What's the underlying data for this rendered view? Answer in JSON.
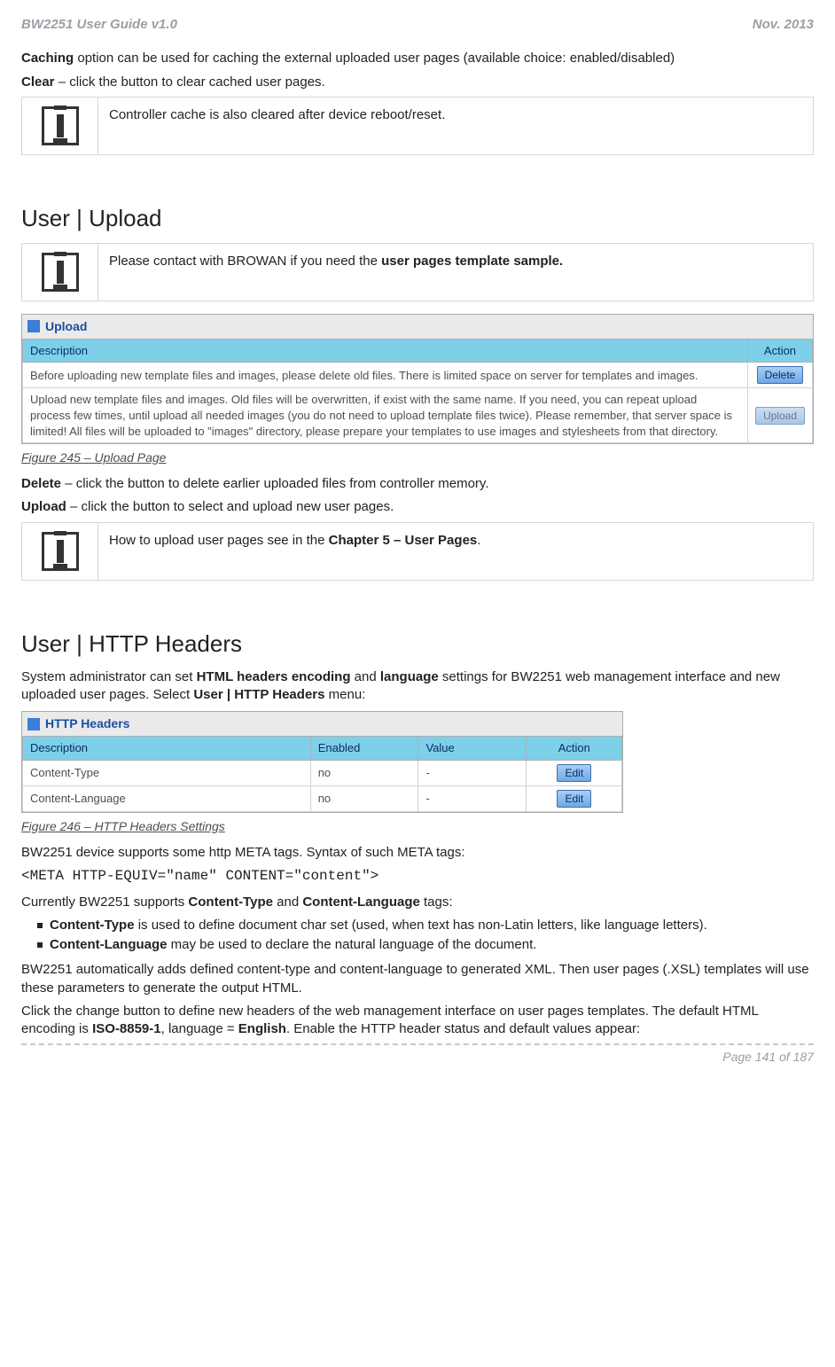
{
  "header": {
    "left": "BW2251 User Guide v1.0",
    "right": "Nov.  2013"
  },
  "footer": {
    "text": "Page 141 of 187"
  },
  "intro": {
    "caching_line": " option can be used for caching the external uploaded user pages (available choice: enabled/disabled)",
    "caching_bold": "Caching",
    "clear_bold": "Clear",
    "clear_line": " – click the button to clear cached user pages.",
    "info1": "Controller cache is also cleared after device reboot/reset."
  },
  "upload": {
    "heading": "User | Upload",
    "info_pre": "Please contact with BROWAN if you need the ",
    "info_bold": "user pages template sample.",
    "panel_title": "Upload",
    "th_desc": "Description",
    "th_action": "Action",
    "rows": [
      {
        "desc": "Before uploading new template files and images, please delete old files. There is limited space on server for templates and images.",
        "btn": "Delete",
        "disabled": false
      },
      {
        "desc": "Upload new template files and images. Old files will be overwritten, if exist with the same name. If you need, you can repeat upload process few times, until upload all needed images (you do not need to upload template files twice). Please remember, that server space is limited! All files will be uploaded to \"images\" directory, please prepare your templates to use images and stylesheets from that directory.",
        "btn": "Upload",
        "disabled": true
      }
    ],
    "fig": "Figure 245 – Upload Page",
    "delete_bold": "Delete",
    "delete_line": " – click the button to delete earlier uploaded files from controller memory.",
    "upload_bold": "Upload",
    "upload_line": " – click the button to select and upload new user pages.",
    "info2_pre": "How to upload user pages see in the ",
    "info2_bold": "Chapter 5 – User Pages",
    "info2_post": "."
  },
  "http": {
    "heading": "User | HTTP Headers",
    "intro_pre": "System administrator can set ",
    "intro_b1": "HTML headers encoding",
    "intro_mid1": " and ",
    "intro_b2": "language",
    "intro_mid2": " settings for BW2251 web management interface and new uploaded user pages. Select ",
    "intro_b3": "User | HTTP Headers",
    "intro_post": " menu:",
    "panel_title": "HTTP Headers",
    "th_desc": "Description",
    "th_enabled": "Enabled",
    "th_value": "Value",
    "th_action": "Action",
    "rows": [
      {
        "desc": "Content-Type",
        "enabled": "no",
        "value": "-",
        "btn": "Edit"
      },
      {
        "desc": "Content-Language",
        "enabled": "no",
        "value": "-",
        "btn": "Edit"
      }
    ],
    "fig": "Figure 246 – HTTP Headers Settings",
    "meta_intro": "BW2251 device supports some http META tags. Syntax of such META tags:",
    "meta_code": "<META HTTP-EQUIV=\"name\" CONTENT=\"content\">",
    "supports_pre": "Currently BW2251 supports ",
    "supports_b1": "Content-Type",
    "supports_mid": " and ",
    "supports_b2": "Content-Language",
    "supports_post": " tags:",
    "bullets": [
      {
        "bold": "Content-Type",
        "rest": " is used to define document char set (used, when text has non-Latin letters, like language letters)."
      },
      {
        "bold": "Content-Language",
        "rest": " may be used to declare the natural language of the document."
      }
    ],
    "auto_line": "BW2251 automatically adds defined content-type and content-language to generated XML. Then user pages (.XSL) templates will use these parameters to generate the output HTML.",
    "closing_pre": "Click the change button to define new headers of the web management interface on user pages templates. The default HTML encoding is ",
    "closing_b1": "ISO-8859-1",
    "closing_mid": ", language = ",
    "closing_b2": "English",
    "closing_post": ". Enable the HTTP header status and default values appear:"
  }
}
